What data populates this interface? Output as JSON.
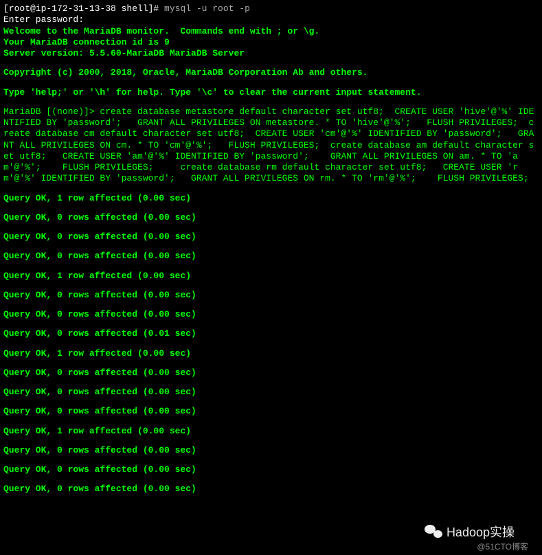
{
  "prompt": "[root@ip-172-31-13-38 shell]# ",
  "cmd": "mysql -u root -p",
  "pw_prompt": "Enter password:",
  "welcome": "Welcome to the MariaDB monitor.  Commands end with ; or \\g.",
  "conn_id": "Your MariaDB connection id is 9",
  "server": "Server version: 5.5.60-MariaDB MariaDB Server",
  "copyright": "Copyright (c) 2000, 2018, Oracle, MariaDB Corporation Ab and others.",
  "help": "Type 'help;' or '\\h' for help. Type '\\c' to clear the current input statement.",
  "sql": "MariaDB [(none)]> create database metastore default character set utf8;  CREATE USER 'hive'@'%' IDENTIFIED BY 'password';   GRANT ALL PRIVILEGES ON metastore. * TO 'hive'@'%';   FLUSH PRIVILEGES;  create database cm default character set utf8;  CREATE USER 'cm'@'%' IDENTIFIED BY 'password';   GRANT ALL PRIVILEGES ON cm. * TO 'cm'@'%';   FLUSH PRIVILEGES;  create database am default character set utf8;   CREATE USER 'am'@'%' IDENTIFIED BY 'password';    GRANT ALL PRIVILEGES ON am. * TO 'am'@'%';    FLUSH PRIVILEGES;     create database rm default character set utf8;   CREATE USER 'rm'@'%' IDENTIFIED BY 'password';   GRANT ALL PRIVILEGES ON rm. * TO 'rm'@'%';    FLUSH PRIVILEGES;",
  "results": [
    "Query OK, 1 row affected (0.00 sec)",
    "Query OK, 0 rows affected (0.00 sec)",
    "Query OK, 0 rows affected (0.00 sec)",
    "Query OK, 0 rows affected (0.00 sec)",
    "Query OK, 1 row affected (0.00 sec)",
    "Query OK, 0 rows affected (0.00 sec)",
    "Query OK, 0 rows affected (0.00 sec)",
    "Query OK, 0 rows affected (0.01 sec)",
    "Query OK, 1 row affected (0.00 sec)",
    "Query OK, 0 rows affected (0.00 sec)",
    "Query OK, 0 rows affected (0.00 sec)",
    "Query OK, 0 rows affected (0.00 sec)",
    "Query OK, 1 row affected (0.00 sec)",
    "Query OK, 0 rows affected (0.00 sec)",
    "Query OK, 0 rows affected (0.00 sec)",
    "Query OK, 0 rows affected (0.00 sec)"
  ],
  "watermark": "Hadoop实操",
  "attr": "@51CTO博客"
}
